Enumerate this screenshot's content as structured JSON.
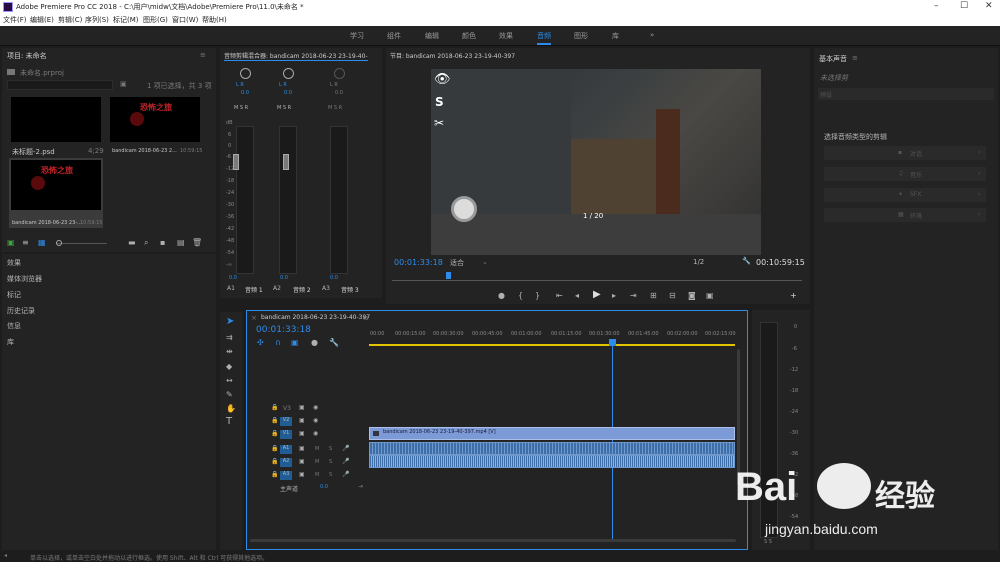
{
  "app": {
    "title": "Adobe Premiere Pro CC 2018 - C:\\用户\\midw\\文档\\Adobe\\Premiere Pro\\11.0\\未命名 *",
    "window_controls": [
      "–",
      "☐",
      "✕"
    ]
  },
  "menu": [
    "文件(F)",
    "编辑(E)",
    "剪辑(C)",
    "序列(S)",
    "标记(M)",
    "图形(G)",
    "窗口(W)",
    "帮助(H)"
  ],
  "workspaces": [
    "学习",
    "组件",
    "编辑",
    "颜色",
    "效果",
    "音频",
    "图形",
    "库"
  ],
  "workspace_more": "»",
  "project": {
    "title": "项目: 未命名",
    "menu_icon": "≡",
    "file": "未命名.prproj",
    "selection": "1 项已选择，共 3 项",
    "items": [
      {
        "name": "未标题-2.psd",
        "duration": "4;29"
      },
      {
        "name": "bandicam 2018-06-23 2...",
        "duration": "10:59:15"
      },
      {
        "name": "bandicam 2018-06-23 23-...",
        "duration": "10:59:15"
      }
    ],
    "thumb_title": "恐怖之旅",
    "panels": [
      "效果",
      "媒体浏览器",
      "标记",
      "历史记录",
      "信息",
      "库"
    ]
  },
  "mixer": {
    "title": "音频剪辑混合器: bandicam 2018-06-23 23-19-40-",
    "channels": [
      {
        "lr": "L   R",
        "val": "0.0",
        "msr": "M S R",
        "out": "0.0",
        "name": "音频 1",
        "id": "A1"
      },
      {
        "lr": "L   R",
        "val": "0.0",
        "msr": "M S R",
        "out": "0.0",
        "name": "音频 2",
        "id": "A2"
      },
      {
        "lr": "L   R",
        "val": "0.0",
        "msr": "M S R",
        "out": "0.0",
        "name": "音频 3",
        "id": "A3"
      }
    ],
    "db_scale": [
      "dB",
      "6",
      "0",
      "-6",
      "-12",
      "-18",
      "-24",
      "-30",
      "-36",
      "-42",
      "-48",
      "-54",
      "-∞"
    ]
  },
  "program": {
    "title": "节目: bandicam 2018-06-23 23-19-40-397",
    "timecode": "00:01:33:18",
    "fit": "适合",
    "quality": "1/2",
    "duration": "00:10:59:15",
    "counter": "1 / 20"
  },
  "timeline": {
    "tab": "bandicam 2018-06-23 23-19-40-397",
    "timecode": "00:01:33:18",
    "ruler": [
      "00:00",
      "00:00:15:00",
      "00:00:30:00",
      "00:00:45:00",
      "00:01:00:00",
      "00:01:15:00",
      "00:01:30:00",
      "00:01:45:00",
      "00:02:00:00",
      "00:02:15:00"
    ],
    "video_tracks": [
      "V3",
      "V2",
      "V1"
    ],
    "audio_tracks": [
      "A1",
      "A2",
      "A3"
    ],
    "master": "主声道",
    "master_val": "0.0",
    "clip_name": "bandicam 2018-06-23 23-19-40-397.mp4 [V]",
    "meter_scale": [
      "0",
      "-6",
      "-12",
      "-18",
      "-24",
      "-30",
      "-36",
      "-42",
      "-48",
      "-54"
    ],
    "meter_foot": "S   S"
  },
  "essential_sound": {
    "title": "基本声音",
    "no_selection": "未选择剪",
    "preset_label": "预设",
    "prompt": "选择音频类型的剪辑",
    "types": [
      "对话",
      "音乐",
      "SFX",
      "环境"
    ]
  },
  "status": "单击以选择，或单击空白处并拖动以进行框选。使用 Shift、Alt 和 Ctrl 可获得其他选项。",
  "watermark": {
    "brand": "Bai",
    "cn": "经验",
    "url": "jingyan.baidu.com"
  }
}
